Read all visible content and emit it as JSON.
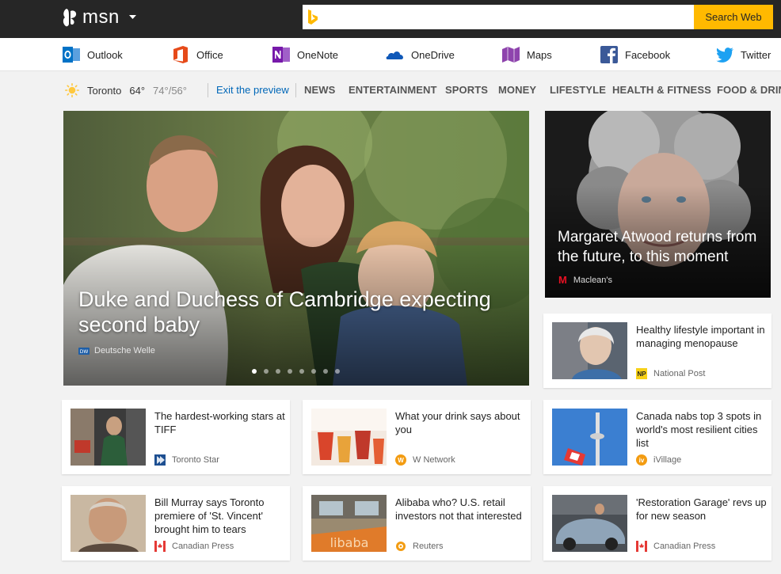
{
  "brand": {
    "name": "msn"
  },
  "search": {
    "placeholder": "",
    "button_label": "Search Web"
  },
  "services": [
    {
      "label": "Outlook"
    },
    {
      "label": "Office"
    },
    {
      "label": "OneNote"
    },
    {
      "label": "OneDrive"
    },
    {
      "label": "Maps"
    },
    {
      "label": "Facebook"
    },
    {
      "label": "Twitter"
    }
  ],
  "weather": {
    "city": "Toronto",
    "temp": "64°",
    "hilo": "74°/56°"
  },
  "preview": {
    "exit_label": "Exit the preview"
  },
  "nav": [
    "NEWS",
    "ENTERTAINMENT",
    "SPORTS",
    "MONEY",
    "LIFESTYLE",
    "HEALTH & FITNESS",
    "FOOD & DRINK"
  ],
  "hero": {
    "title": "Duke and Duchess of Cambridge expecting second baby",
    "source": "Deutsche Welle",
    "slide_count": 8,
    "active_slide": 1
  },
  "feature": {
    "title": "Margaret Atwood returns from the future, to this moment",
    "source": "Maclean's"
  },
  "cards": [
    {
      "title": "Healthy lifestyle important in managing menopause",
      "source": "National Post",
      "source_logo": "NP"
    },
    {
      "title": "The hardest-working stars at TIFF",
      "source": "Toronto Star",
      "source_logo": ""
    },
    {
      "title": "What your drink says about you",
      "source": "W Network",
      "source_logo": "W"
    },
    {
      "title": "Canada nabs top 3 spots in world's most resilient cities list",
      "source": "iVillage",
      "source_logo": "iv"
    },
    {
      "title": "Bill Murray says Toronto premiere of 'St. Vincent' brought him to tears",
      "source": "Canadian Press",
      "source_logo": ""
    },
    {
      "title": "Alibaba who? U.S. retail investors not that interested",
      "source": "Reuters",
      "source_logo": ""
    },
    {
      "title": "'Restoration Garage' revs up for new season",
      "source": "Canadian Press",
      "source_logo": ""
    }
  ],
  "colors": {
    "topbar": "#262626",
    "search_button": "#ffb900",
    "link": "#0067b8",
    "page_bg": "#f2f2f2"
  }
}
